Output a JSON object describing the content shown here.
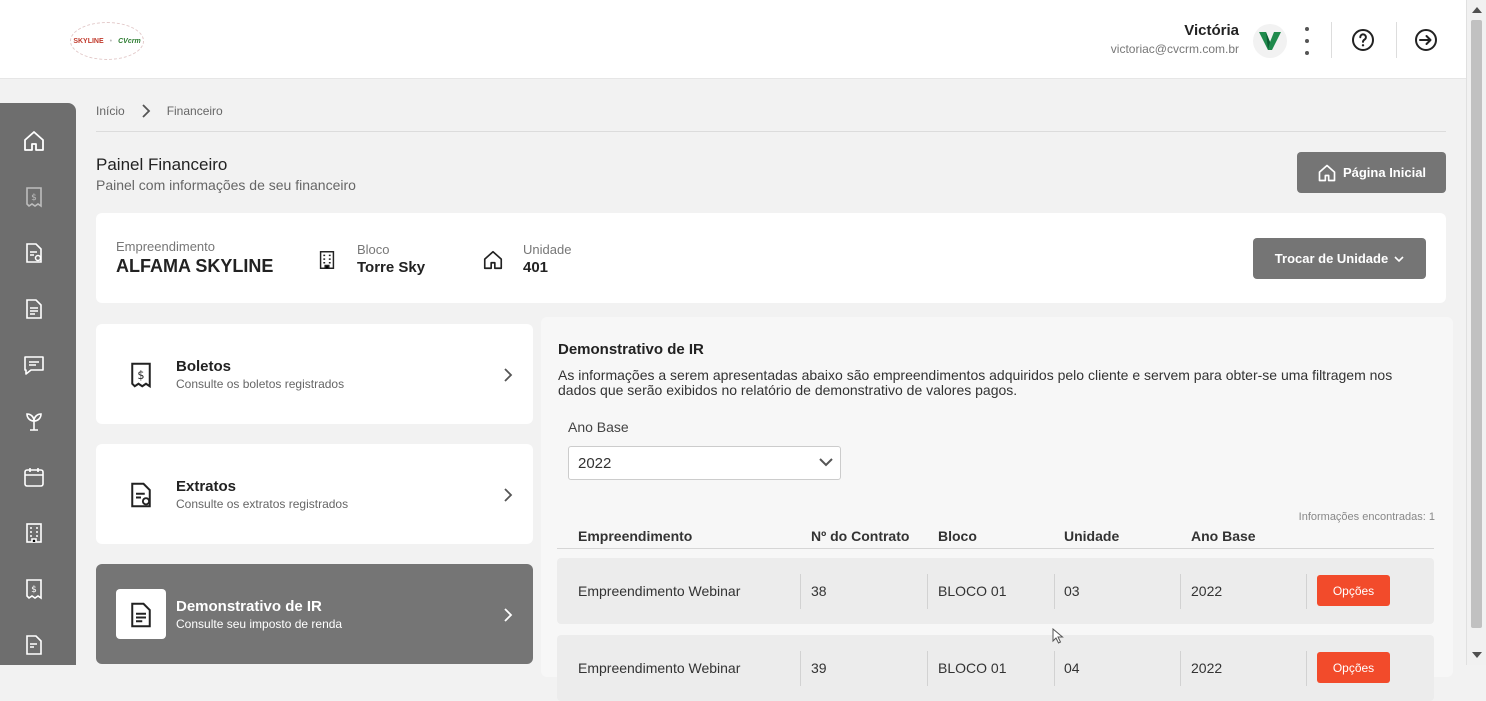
{
  "header": {
    "logo": {
      "left": "SKYLINE",
      "right": "CVcrm"
    },
    "user_name": "Victória",
    "user_email": "victoriac@cvcrm.com.br"
  },
  "sidebar": {
    "items": [
      "home-icon",
      "boleto-icon",
      "extrato-icon",
      "document-icon",
      "chat-icon",
      "plant-icon",
      "calendar-icon",
      "building-icon",
      "boleto-icon",
      "extrato-icon"
    ]
  },
  "breadcrumb": {
    "items": [
      "Início",
      "Financeiro"
    ]
  },
  "page": {
    "title": "Painel Financeiro",
    "subtitle": "Painel com informações de seu financeiro",
    "home_button": "Página Inicial"
  },
  "unit": {
    "empreendimento_label": "Empreendimento",
    "empreendimento_value": "ALFAMA SKYLINE",
    "bloco_label": "Bloco",
    "bloco_value": "Torre Sky",
    "unidade_label": "Unidade",
    "unidade_value": "401",
    "trocar_button": "Trocar de Unidade"
  },
  "menu": [
    {
      "title": "Boletos",
      "subtitle": "Consulte os boletos registrados"
    },
    {
      "title": "Extratos",
      "subtitle": "Consulte os extratos registrados"
    },
    {
      "title": "Demonstrativo de IR",
      "subtitle": "Consulte seu imposto de renda"
    }
  ],
  "ir": {
    "title": "Demonstrativo de IR",
    "description": "As informações a serem apresentadas abaixo são empreendimentos adquiridos pelo cliente e servem para obter-se uma filtragem nos dados que serão exibidos no relatório de demonstrativo de valores pagos.",
    "ano_label": "Ano Base",
    "ano_value": "2022",
    "info_count": "Informações encontradas: 1",
    "columns": [
      "Empreendimento",
      "Nº do Contrato",
      "Bloco",
      "Unidade",
      "Ano Base"
    ],
    "rows": [
      {
        "empreendimento": "Empreendimento Webinar",
        "contrato": "38",
        "bloco": "BLOCO 01",
        "unidade": "03",
        "ano": "2022",
        "action": "Opções"
      },
      {
        "empreendimento": "Empreendimento Webinar",
        "contrato": "39",
        "bloco": "BLOCO 01",
        "unidade": "04",
        "ano": "2022",
        "action": "Opções"
      }
    ]
  },
  "colors": {
    "accent": "#f24b2b",
    "gray_button": "#757575",
    "sidebar": "#6e6e6e"
  }
}
